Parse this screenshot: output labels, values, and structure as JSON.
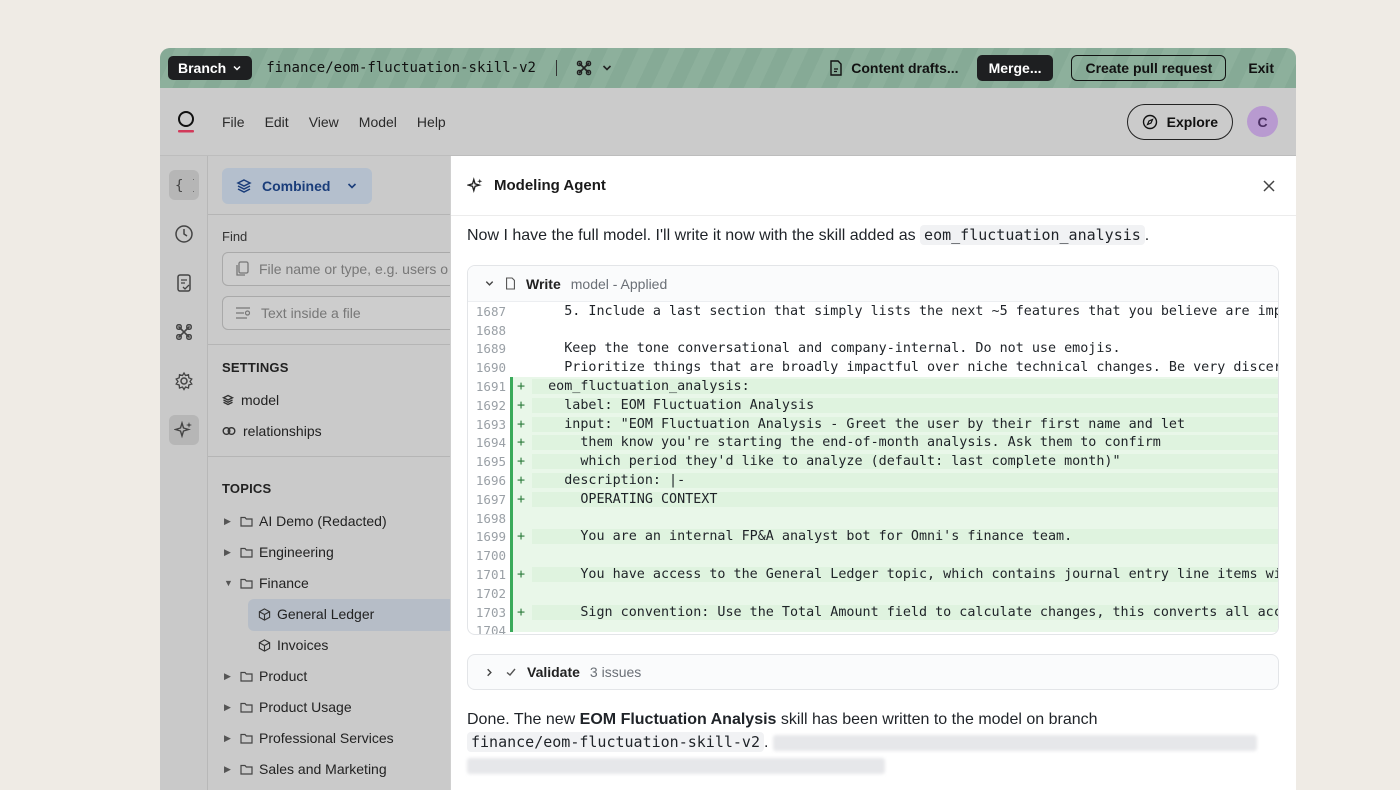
{
  "branchbar": {
    "branch_label": "Branch",
    "branch_name": "finance/eom-fluctuation-skill-v2",
    "content_drafts": "Content drafts...",
    "merge": "Merge...",
    "create_pr": "Create pull request",
    "exit": "Exit"
  },
  "menubar": {
    "menus": [
      "File",
      "Edit",
      "View",
      "Model",
      "Help"
    ],
    "explore": "Explore",
    "avatar": "C"
  },
  "sidebar": {
    "view_selector": "Combined",
    "find_label": "Find",
    "file_placeholder": "File name or type, e.g. users o",
    "text_placeholder": "Text inside a file",
    "settings_head": "SETTINGS",
    "settings": [
      "model",
      "relationships"
    ],
    "topics_head": "TOPICS",
    "topics": [
      "AI Demo (Redacted)",
      "Engineering",
      "Finance",
      "General Ledger",
      "Invoices",
      "Product",
      "Product Usage",
      "Professional Services",
      "Sales and Marketing"
    ]
  },
  "agent": {
    "title": "Modeling Agent",
    "msg1_prefix": "Now I have the full model. I'll write it now with the skill added as",
    "msg1_code": "eom_fluctuation_analysis",
    "msg1_suffix": ".",
    "write_title": "Write",
    "write_status": "model - Applied",
    "code_lines": [
      {
        "n": "1687",
        "mark": "",
        "text": "    5. Include a last section that simply lists the next ~5 features that you believe are imp"
      },
      {
        "n": "1688",
        "mark": "",
        "text": ""
      },
      {
        "n": "1689",
        "mark": "",
        "text": "    Keep the tone conversational and company-internal. Do not use emojis."
      },
      {
        "n": "1690",
        "mark": "",
        "text": "    Prioritize things that are broadly impactful over niche technical changes. Be very discer"
      },
      {
        "n": "1691",
        "mark": "+",
        "text": "  eom_fluctuation_analysis:"
      },
      {
        "n": "1692",
        "mark": "+",
        "text": "    label: EOM Fluctuation Analysis"
      },
      {
        "n": "1693",
        "mark": "+",
        "text": "    input: \"EOM Fluctuation Analysis - Greet the user by their first name and let"
      },
      {
        "n": "1694",
        "mark": "+",
        "text": "      them know you're starting the end-of-month analysis. Ask them to confirm"
      },
      {
        "n": "1695",
        "mark": "+",
        "text": "      which period they'd like to analyze (default: last complete month)\""
      },
      {
        "n": "1696",
        "mark": "+",
        "text": "    description: |-"
      },
      {
        "n": "1697",
        "mark": "+",
        "text": "      OPERATING CONTEXT"
      },
      {
        "n": "1698",
        "mark": "",
        "text": ""
      },
      {
        "n": "1699",
        "mark": "+",
        "text": "      You are an internal FP&A analyst bot for Omni's finance team."
      },
      {
        "n": "1700",
        "mark": "",
        "text": ""
      },
      {
        "n": "1701",
        "mark": "+",
        "text": "      You have access to the General Ledger topic, which contains journal entry line items wi"
      },
      {
        "n": "1702",
        "mark": "",
        "text": ""
      },
      {
        "n": "1703",
        "mark": "+",
        "text": "      Sign convention: Use the Total Amount field to calculate changes, this converts all acc"
      },
      {
        "n": "1704",
        "mark": "",
        "text": ""
      }
    ],
    "validate_title": "Validate",
    "validate_status": "3 issues",
    "msg2_prefix": "Done. The new",
    "msg2_bold": "EOM Fluctuation Analysis",
    "msg2_suffix": "skill has been written to the model on branch",
    "msg2_code": "finance/eom-fluctuation-skill-v2",
    "msg2_dot": "."
  }
}
